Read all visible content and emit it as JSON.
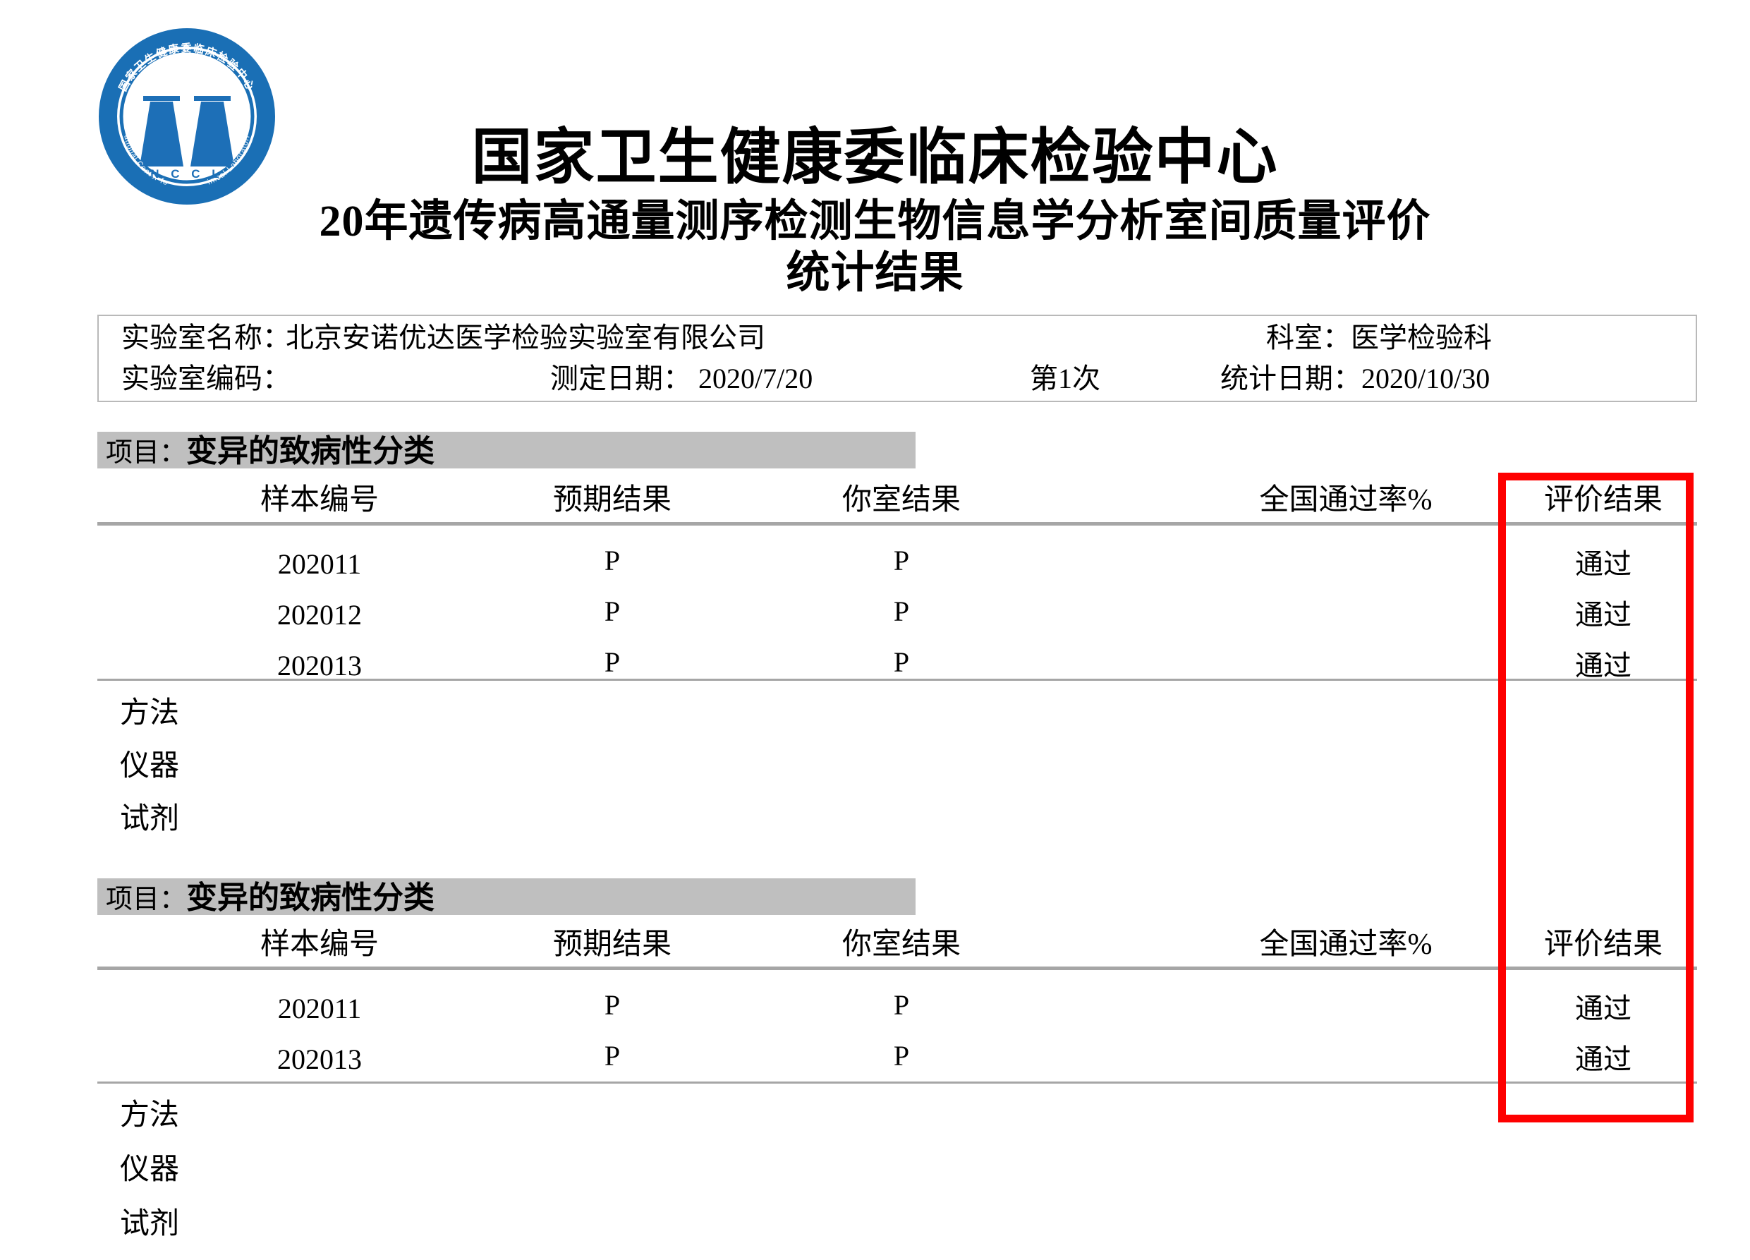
{
  "header": {
    "logo_alt": "national-center-for-clinical-laboratories-seal",
    "logo_ring_text_cn": "国家卫生健康委临床检验中心",
    "logo_ring_text_en_top": "National Center for",
    "logo_ring_text_en_bottom": "Clinical Laboratories",
    "logo_initials": "N C C L",
    "title_main": "国家卫生健康委临床检验中心",
    "title_sub": "20年遗传病高通量测序检测生物信息学分析室间质量评价",
    "title_sub2": "统计结果"
  },
  "info": {
    "lab_name_label": "实验室名称：",
    "lab_name_value": "北京安诺优达医学检验实验室有限公司",
    "dept_label": "科室：医学检验科",
    "lab_code_label": "实验室编码：",
    "lab_code_value": ".",
    "test_date_label": "测定日期： 2020/7/20",
    "round_label": "第1次",
    "stat_date_label": "统计日期：2020/10/30"
  },
  "table_headers": {
    "sample": "样本编号",
    "expected": "预期结果",
    "yours": "你室结果",
    "national": "全国通过率%",
    "evaluation": "评价结果"
  },
  "meta_labels": {
    "method": "方法",
    "instrument": "仪器",
    "reagent": "试剂"
  },
  "sections": [
    {
      "title_prefix": "项目：",
      "title_name": "变异的致病性分类",
      "rows": [
        {
          "sample": "202011",
          "expected": "P",
          "yours": "P",
          "national": "",
          "evaluation": "通过"
        },
        {
          "sample": "202012",
          "expected": "P",
          "yours": "P",
          "national": "",
          "evaluation": "通过"
        },
        {
          "sample": "202013",
          "expected": "P",
          "yours": "P",
          "national": "",
          "evaluation": "通过"
        }
      ],
      "method_value": "",
      "instrument_value": "",
      "reagent_value": ""
    },
    {
      "title_prefix": "项目：",
      "title_name": "变异的致病性分类",
      "rows": [
        {
          "sample": "202011",
          "expected": "P",
          "yours": "P",
          "national": "",
          "evaluation": "通过"
        },
        {
          "sample": "202013",
          "expected": "P",
          "yours": "P",
          "national": "",
          "evaluation": "通过"
        }
      ],
      "method_value": "",
      "instrument_value": "",
      "reagent_value": ""
    }
  ],
  "annotation": {
    "highlight_color": "#fe0000",
    "highlight_name": "evaluation-column-highlight"
  }
}
